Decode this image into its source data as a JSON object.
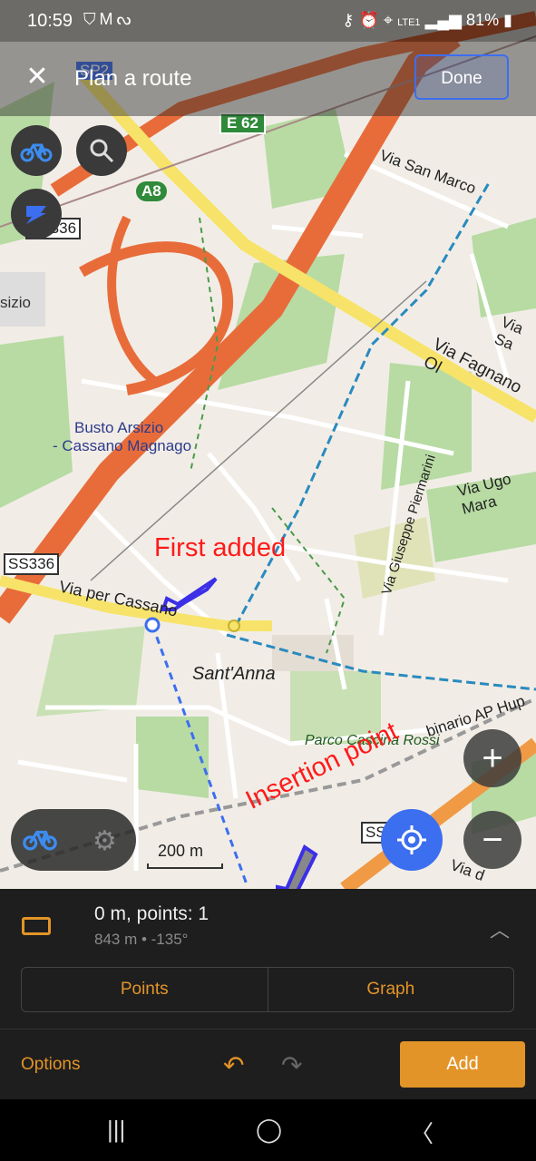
{
  "status_bar": {
    "time": "10:59",
    "left_icons": [
      "shield-icon",
      "gmail-icon",
      "sync-icon"
    ],
    "network": "LTE1",
    "battery": "81%"
  },
  "header": {
    "title": "Plan a route",
    "done_label": "Done"
  },
  "map": {
    "labels": {
      "sp2": "SP2",
      "e62": "E 62",
      "a8": "A8",
      "ss336_top": "SS336",
      "sizio": "sizio",
      "via_san_marco": "Via San Marco",
      "via_sa": "Via Sa",
      "via_fagnano": "Via Fagnano Ol",
      "busto": "Busto Arsizio",
      "cassano": "- Cassano Magnago",
      "via_giuseppe": "Via Giuseppe Piermarini",
      "via_ugo": "Via Ugo Mara",
      "ss336_left": "SS336",
      "via_per_cassano": "Via per Cassano",
      "santanna": "Sant'Anna",
      "parco": "Parco Cascina Rossi",
      "binario": "binario AP Hup",
      "ss_bottom": "SS",
      "via_d": "Via d"
    },
    "scale_label": "200 m"
  },
  "annotations": {
    "first_added": "First added",
    "insertion_point": "Insertion point"
  },
  "panel": {
    "distance": "0 m, points: 1",
    "sub": "843 m • -135°",
    "tabs": [
      "Points",
      "Graph"
    ],
    "options_label": "Options",
    "add_label": "Add"
  },
  "colors": {
    "accent": "#e39428",
    "blue": "#3c6ef0",
    "annotation": "#ff1a1a"
  }
}
